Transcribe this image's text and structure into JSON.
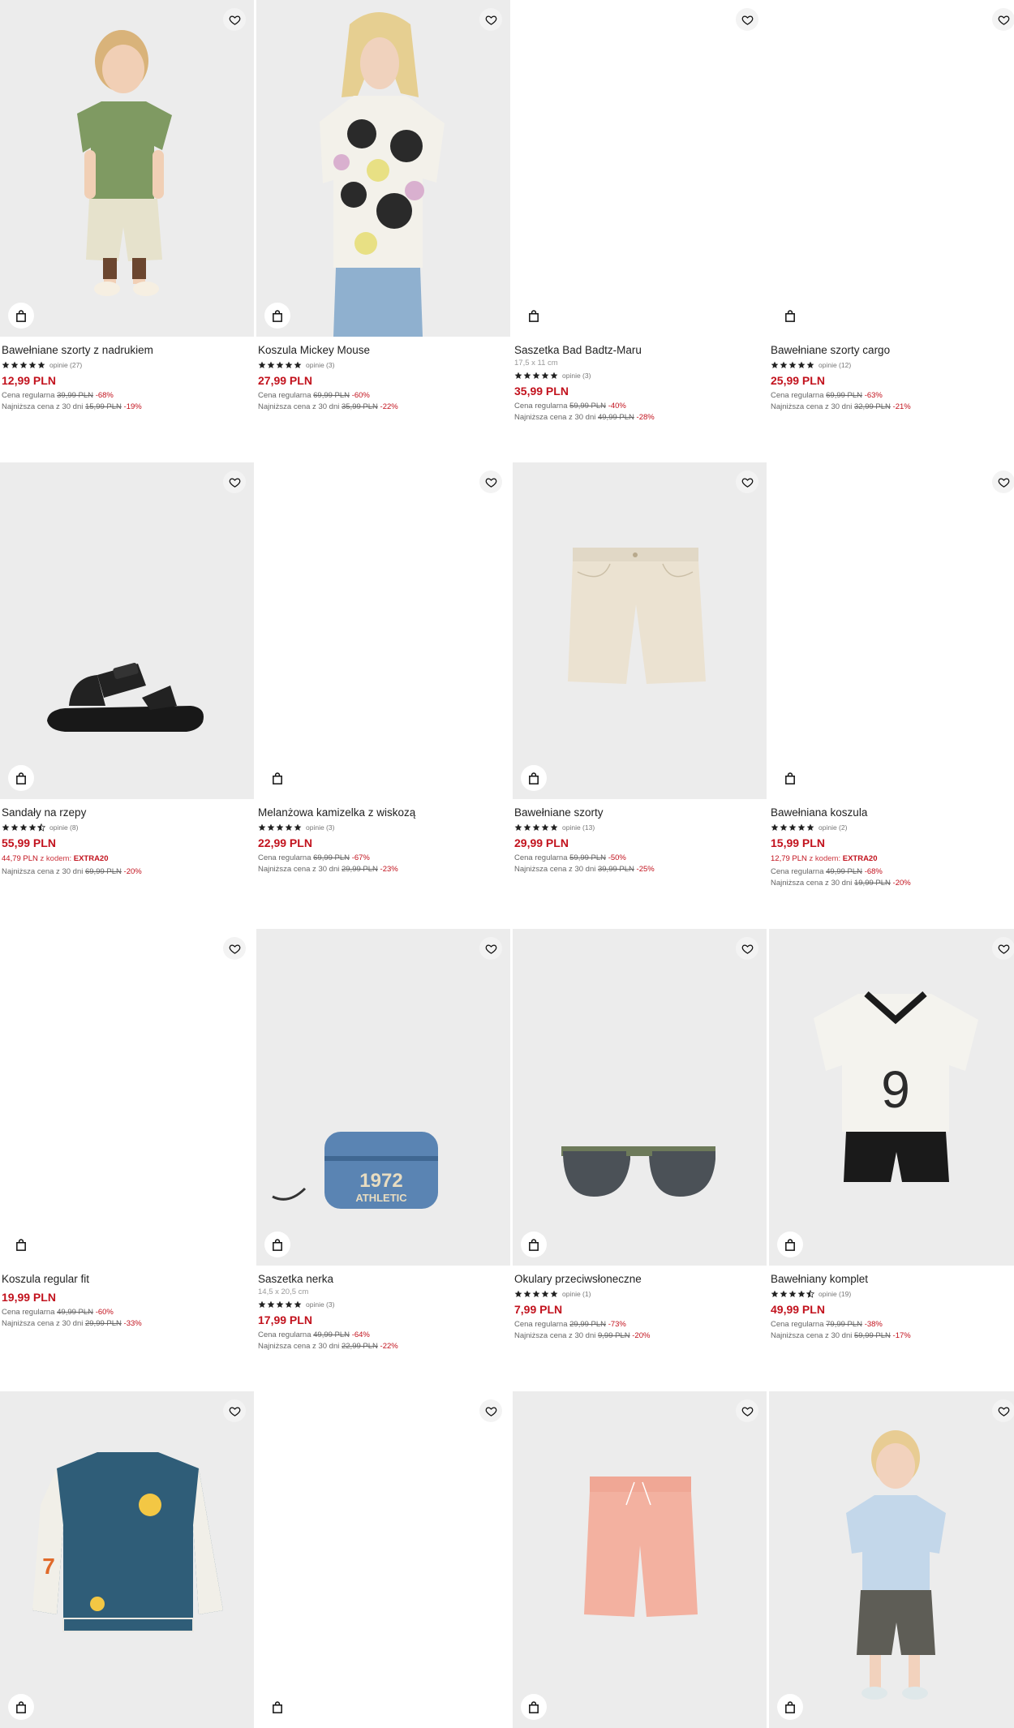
{
  "labels": {
    "regular": "Cena regularna",
    "lowest": "Najniższa cena z 30 dni",
    "with_code": "z kodem:"
  },
  "products": [
    {
      "name": "Bawełniane szorty z nadrukiem",
      "stars": 5,
      "reviews": "opinie (27)",
      "price": "12,99 PLN",
      "regular": "39,99 PLN",
      "regular_disc": "-68%",
      "lowest": "15,99 PLN",
      "lowest_disc": "-19%",
      "photo": "kid-tshirt-shorts"
    },
    {
      "name": "Koszula Mickey Mouse",
      "stars": 5,
      "reviews": "opinie (3)",
      "price": "27,99 PLN",
      "regular": "69,99 PLN",
      "regular_disc": "-60%",
      "lowest": "35,99 PLN",
      "lowest_disc": "-22%",
      "photo": "kid-mickey-shirt"
    },
    {
      "name": "Saszetka Bad Badtz-Maru",
      "dims": "17,5 x 11 cm",
      "stars": 5,
      "reviews": "opinie (3)",
      "price": "35,99 PLN",
      "regular": "59,99 PLN",
      "regular_disc": "-40%",
      "lowest": "49,99 PLN",
      "lowest_disc": "-28%",
      "photo": "blank"
    },
    {
      "name": "Bawełniane szorty cargo",
      "stars": 5,
      "reviews": "opinie (12)",
      "price": "25,99 PLN",
      "regular": "69,99 PLN",
      "regular_disc": "-63%",
      "lowest": "32,99 PLN",
      "lowest_disc": "-21%",
      "photo": "blank"
    },
    {
      "name": "Sandały na rzepy",
      "stars": 4.5,
      "reviews": "opinie (8)",
      "price": "55,99 PLN",
      "promo_price": "44,79 PLN",
      "promo_code": "EXTRA20",
      "lowest": "69,99 PLN",
      "lowest_disc": "-20%",
      "photo": "sandal"
    },
    {
      "name": "Melanżowa kamizelka z wiskozą",
      "stars": 5,
      "reviews": "opinie (3)",
      "price": "22,99 PLN",
      "regular": "69,99 PLN",
      "regular_disc": "-67%",
      "lowest": "29,99 PLN",
      "lowest_disc": "-23%",
      "photo": "blank"
    },
    {
      "name": "Bawełniane szorty",
      "stars": 5,
      "reviews": "opinie (13)",
      "price": "29,99 PLN",
      "regular": "59,99 PLN",
      "regular_disc": "-50%",
      "lowest": "39,99 PLN",
      "lowest_disc": "-25%",
      "photo": "beige-shorts"
    },
    {
      "name": "Bawełniana koszula",
      "stars": 5,
      "reviews": "opinie (2)",
      "price": "15,99 PLN",
      "promo_price": "12,79 PLN",
      "promo_code": "EXTRA20",
      "regular": "49,99 PLN",
      "regular_disc": "-68%",
      "lowest": "19,99 PLN",
      "lowest_disc": "-20%",
      "photo": "blank"
    },
    {
      "name": "Koszula regular fit",
      "price": "19,99 PLN",
      "regular": "49,99 PLN",
      "regular_disc": "-60%",
      "lowest": "29,99 PLN",
      "lowest_disc": "-33%",
      "photo": "blank"
    },
    {
      "name": "Saszetka nerka",
      "dims": "14,5 x 20,5 cm",
      "stars": 5,
      "reviews": "opinie (3)",
      "price": "17,99 PLN",
      "regular": "49,99 PLN",
      "regular_disc": "-64%",
      "lowest": "22,99 PLN",
      "lowest_disc": "-22%",
      "photo": "waist-bag",
      "bag_text1": "1972",
      "bag_text2": "ATHLETIC"
    },
    {
      "name": "Okulary przeciwsłoneczne",
      "stars": 5,
      "reviews": "opinie (1)",
      "price": "7,99 PLN",
      "regular": "29,99 PLN",
      "regular_disc": "-73%",
      "lowest": "9,99 PLN",
      "lowest_disc": "-20%",
      "photo": "sunglasses"
    },
    {
      "name": "Bawełniany komplet",
      "stars": 4.5,
      "reviews": "opinie (19)",
      "price": "49,99 PLN",
      "regular": "79,99 PLN",
      "regular_disc": "-38%",
      "lowest": "59,99 PLN",
      "lowest_disc": "-17%",
      "photo": "football-set",
      "jersey_number": "9"
    },
    {
      "name": "",
      "photo": "varsity-jacket",
      "jacket_number": "7"
    },
    {
      "name": "",
      "photo": "blank"
    },
    {
      "name": "",
      "photo": "coral-shorts"
    },
    {
      "name": "",
      "photo": "kid-polo"
    }
  ],
  "icons": {
    "favorite": "heart-icon",
    "cart": "shopping-bag-icon",
    "rating": "star-icon"
  },
  "colors": {
    "price": "#c2121d",
    "photo_bg": "#ececec",
    "text": "#222222"
  }
}
